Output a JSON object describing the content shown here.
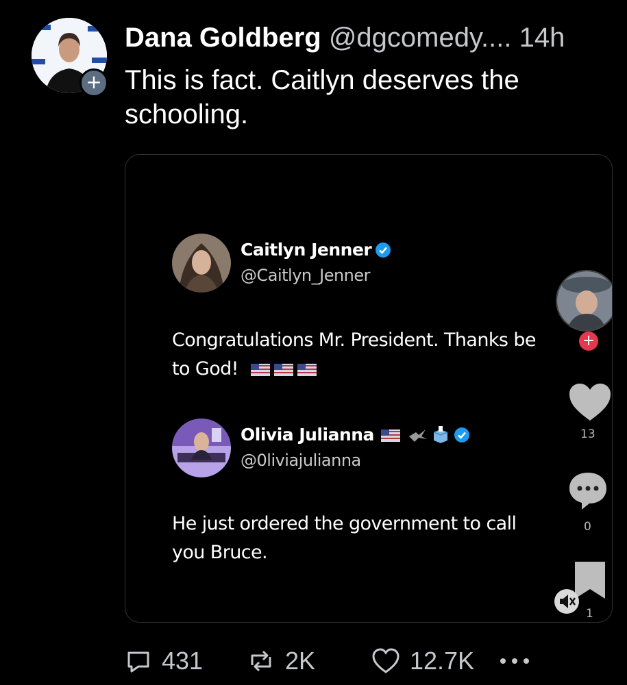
{
  "post": {
    "author_name": "Dana Goldberg",
    "author_handle": "@dgcomedy....",
    "timestamp": "14h",
    "text": "This is fact. Caitlyn deserves the schooling.",
    "follow_symbol": "+"
  },
  "embedded_video": {
    "tweet1": {
      "name": "Caitlyn Jenner",
      "handle": "@Caitlyn_Jenner",
      "text_line1": "Congratulations Mr. President. Thanks be",
      "text_line2": "to God!",
      "verified": true
    },
    "tweet2": {
      "name": "Olivia Julianna",
      "handle": "@0liviajulianna",
      "text_line1": "He just ordered the government to call",
      "text_line2": "you Bruce.",
      "verified": true
    },
    "side_actions": {
      "like_count": "13",
      "comment_count": "0",
      "save_count": "1"
    }
  },
  "actions": {
    "replies": "431",
    "reposts": "2K",
    "likes": "12.7K",
    "more_icon": "more-horizontal-icon"
  },
  "colors": {
    "background": "#000000",
    "text": "#e7e9ea",
    "secondary_text": "#c6c9cc",
    "verified_blue": "#1d9bf0"
  }
}
